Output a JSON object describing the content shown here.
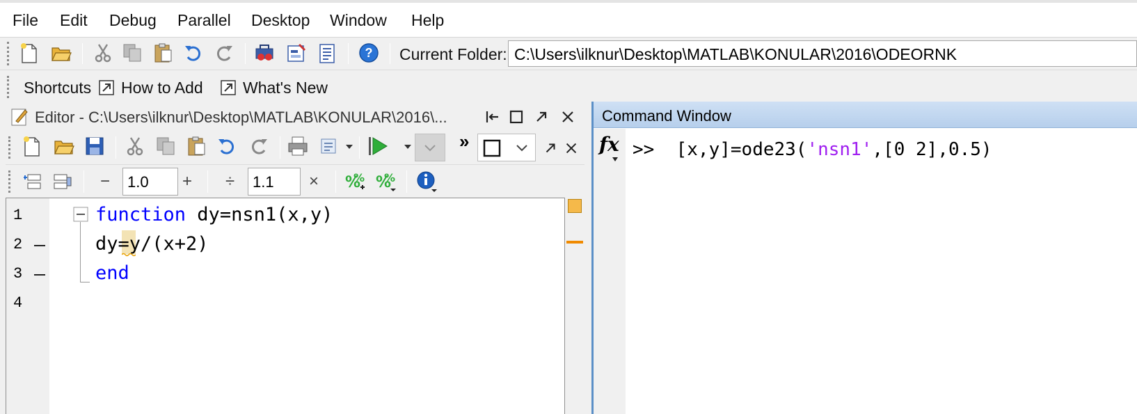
{
  "menu": [
    "File",
    "Edit",
    "Debug",
    "Parallel",
    "Desktop",
    "Window",
    "Help"
  ],
  "main_toolbar": {
    "icons": [
      "new-file-icon",
      "open-folder-icon",
      "cut-icon",
      "copy-icon",
      "paste-icon",
      "undo-icon",
      "redo-icon",
      "simulink-icon",
      "guide-icon",
      "profiler-icon",
      "help-icon"
    ],
    "current_folder_label": "Current Folder:",
    "current_folder_value": "C:\\Users\\ilknur\\Desktop\\MATLAB\\KONULAR\\2016\\ODEORNK"
  },
  "shortcuts_bar": {
    "shortcuts_label": "Shortcuts",
    "how_to_add": "How to Add",
    "whats_new": "What's New"
  },
  "editor": {
    "title": "Editor - C:\\Users\\ilknur\\Desktop\\MATLAB\\KONULAR\\2016\\...",
    "overflow": "»",
    "cell_toolbar": {
      "minus": "−",
      "field1": "1.0",
      "plus": "+",
      "divide": "÷",
      "field2": "1.1",
      "times": "×"
    },
    "line_numbers": [
      "1",
      "2",
      "3",
      "4"
    ],
    "lines": {
      "l1_kw": "function",
      "l1_rest": " dy=nsn1(x,y)",
      "l2": "dy=y/(x+2)",
      "l3_kw": "end"
    }
  },
  "command_window": {
    "title": "Command Window",
    "fx": "fx",
    "prompt": ">>",
    "cmd_pre": "[x,y]=ode23(",
    "cmd_str": "'nsn1'",
    "cmd_post": ",[0 2],0.5)"
  },
  "colors": {
    "keyword": "#0000ff",
    "string": "#a020f0",
    "title_bar": "#b6cfec"
  }
}
